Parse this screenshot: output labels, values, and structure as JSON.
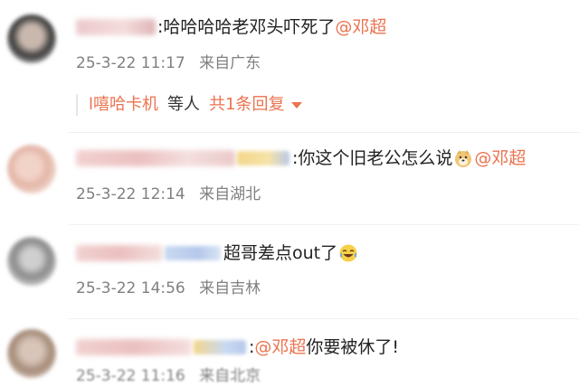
{
  "comments": [
    {
      "text": ":哈哈哈哈老邓头吓死了",
      "mention": "@邓超",
      "date": "25-3-22 11:17",
      "location": "来自广东",
      "replies": {
        "user": "l嘻哈卡机",
        "suffix": "等人",
        "count": "共1条回复"
      }
    },
    {
      "text": ":你这个旧老公怎么说",
      "emoji": "doge-emoji",
      "mention": "@邓超",
      "date": "25-3-22 12:14",
      "location": "来自湖北"
    },
    {
      "text": "超哥差点out了",
      "emoji": "laugh-cry-emoji",
      "date": "25-3-22 14:56",
      "location": "来自吉林"
    },
    {
      "text_before": ":",
      "mention": "@邓超",
      "text": " 你要被休了!",
      "date": "25-3-22 11:16",
      "location": "来自北京"
    }
  ],
  "colors": {
    "mention": "#eb7350",
    "meta": "#808080"
  }
}
